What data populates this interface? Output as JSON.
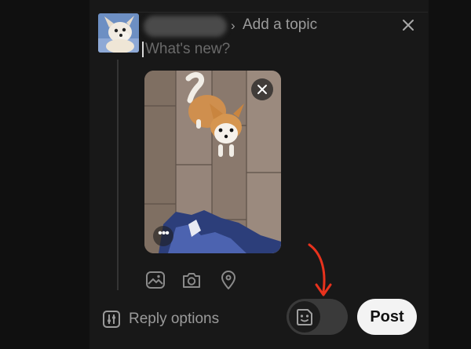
{
  "composer": {
    "topic_label": "Add a topic",
    "placeholder": "What's new?"
  },
  "footer": {
    "reply_options_label": "Reply options",
    "post_label": "Post"
  },
  "attachments": {
    "icons": [
      "gallery-icon",
      "camera-icon",
      "location-icon"
    ]
  },
  "overlay": {
    "annotation_color": "#e8321d"
  }
}
